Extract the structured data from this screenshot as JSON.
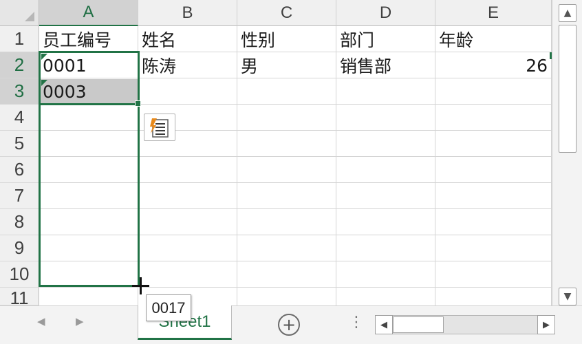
{
  "columns": [
    "A",
    "B",
    "C",
    "D",
    "E"
  ],
  "rows": [
    "1",
    "2",
    "3",
    "4",
    "5",
    "6",
    "7",
    "8",
    "9",
    "10",
    "11"
  ],
  "cells": {
    "A1": "员工编号",
    "B1": "姓名",
    "C1": "性别",
    "D1": "部门",
    "E1": "年龄",
    "A2": "0001",
    "B2": "陈涛",
    "C2": "男",
    "D2": "销售部",
    "E2": "26",
    "A3": "0003"
  },
  "fill_tooltip": "0017",
  "sheet_tab": "Sheet1",
  "icons": {
    "add_sheet": "+",
    "sheet_prev": "◀",
    "sheet_next": "▶",
    "scroll_up": "▲",
    "scroll_down": "▼",
    "scroll_left": "◀",
    "scroll_right": "▶",
    "more": "⋮"
  },
  "colors": {
    "accent": "#217346",
    "header_bg": "#f0f0f0",
    "selected_fill": "#c9c9c9"
  }
}
